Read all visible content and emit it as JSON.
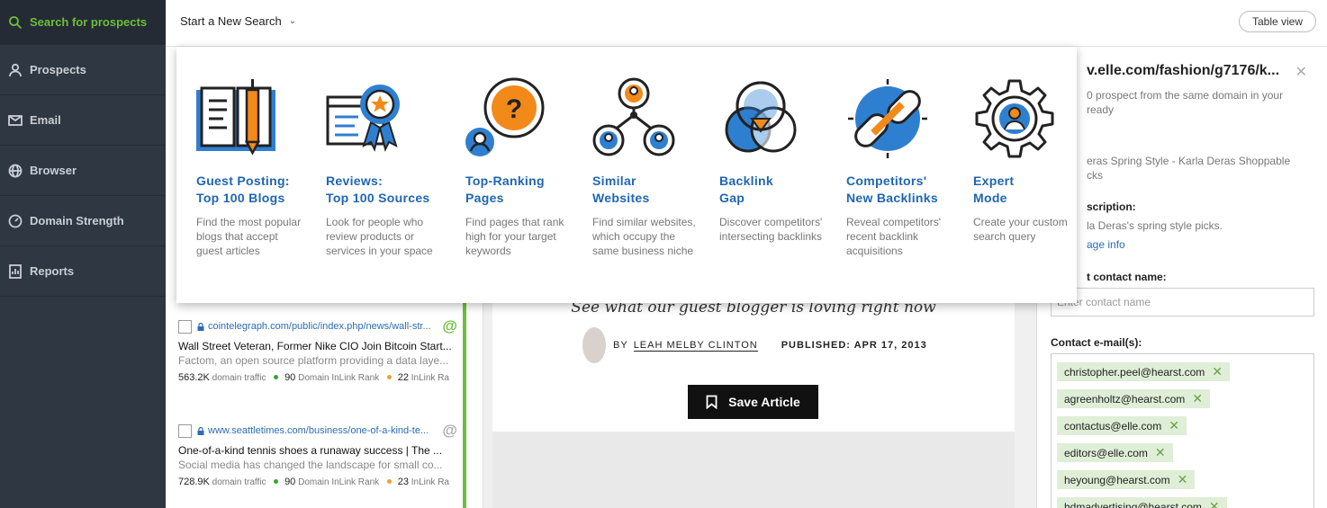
{
  "sidebar": {
    "items": [
      {
        "label": "Search for prospects",
        "icon": "search-icon",
        "active": true
      },
      {
        "label": "Prospects",
        "icon": "user-icon"
      },
      {
        "label": "Email",
        "icon": "envelope-icon"
      },
      {
        "label": "Browser",
        "icon": "globe-icon"
      },
      {
        "label": "Domain Strength",
        "icon": "gauge-icon"
      },
      {
        "label": "Reports",
        "icon": "report-icon"
      }
    ]
  },
  "topbar": {
    "start_search_label": "Start a New Search",
    "table_view_label": "Table view"
  },
  "search_types": [
    {
      "title_line1": "Guest Posting:",
      "title_line2": "Top 100 Blogs",
      "description": "Find the most popular blogs that accept guest articles"
    },
    {
      "title_line1": "Reviews:",
      "title_line2": "Top 100 Sources",
      "description": "Look for people who review products or services in your space"
    },
    {
      "title_line1": "Top-Ranking",
      "title_line2": "Pages",
      "description": "Find pages that rank high for your target keywords"
    },
    {
      "title_line1": "Similar",
      "title_line2": "Websites",
      "description": "Find similar websites, which occupy the same business niche"
    },
    {
      "title_line1": "Backlink",
      "title_line2": "Gap",
      "description": "Discover competitors' intersecting backlinks"
    },
    {
      "title_line1": "Competitors'",
      "title_line2": "New Backlinks",
      "description": "Reveal competitors' recent backlink acquisitions"
    },
    {
      "title_line1": "Expert",
      "title_line2": "Mode",
      "description": "Create your custom search query"
    }
  ],
  "results": [
    {
      "url": "cointelegraph.com/public/index.php/news/wall-str...",
      "title": "Wall Street Veteran, Former Nike CIO Join Bitcoin Start...",
      "snippet": "Factom, an open source platform providing a data laye...",
      "traffic": "563.2K",
      "traffic_label": "domain traffic",
      "domain_rank": "90",
      "domain_rank_label": "Domain InLink Rank",
      "inlink_rank": "22",
      "inlink_rank_label": "InLink Ra",
      "has_email": true
    },
    {
      "url": "www.seattletimes.com/business/one-of-a-kind-te...",
      "title": "One-of-a-kind tennis shoes a runaway success | The ...",
      "snippet": "Social media has changed the landscape for small co...",
      "traffic": "728.9K",
      "traffic_label": "domain traffic",
      "domain_rank": "90",
      "domain_rank_label": "Domain InLink Rank",
      "inlink_rank": "23",
      "inlink_rank_label": "InLink Ra",
      "has_email": false
    }
  ],
  "preview": {
    "tagline": "See what our guest blogger is loving right now",
    "by_label": "BY",
    "author": "LEAH MELBY CLINTON",
    "published": "PUBLISHED: APR 17, 2013",
    "save_label": "Save Article"
  },
  "panel": {
    "url": "v.elle.com/fashion/g7176/k...",
    "note_line1": "0 prospect from the same domain in your",
    "note_line2": "ready",
    "page_title_line1": "eras Spring Style - Karla Deras Shoppable",
    "page_title_line2": "cks",
    "description_label": "scription:",
    "description_text": "la Deras's spring style picks.",
    "page_info_link": "age info",
    "contact_name_label": "t contact name:",
    "contact_name_placeholder": "Enter contact name",
    "emails_label": "Contact e-mail(s):",
    "emails": [
      "christopher.peel@hearst.com",
      "agreenholtz@hearst.com",
      "contactus@elle.com",
      "editors@elle.com",
      "heyoung@hearst.com",
      "hdmadvertising@hearst.com"
    ]
  },
  "colors": {
    "sidebar_bg": "#2f3742",
    "accent_green": "#6cbf3a",
    "link_blue": "#1f66b3",
    "icon_orange": "#f28a1a"
  }
}
